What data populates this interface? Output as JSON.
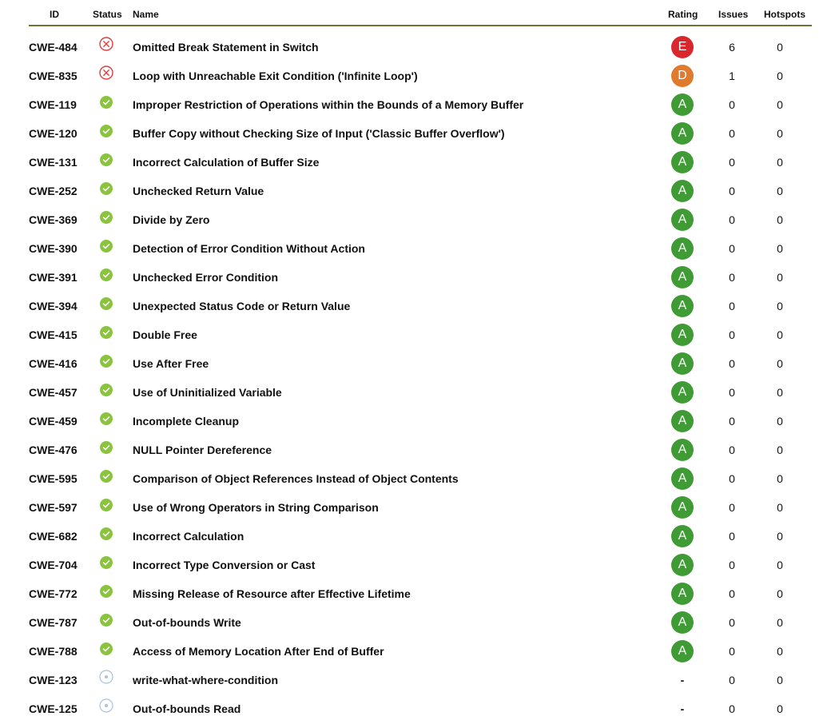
{
  "table": {
    "headers": {
      "id": "ID",
      "status": "Status",
      "name": "Name",
      "rating": "Rating",
      "issues": "Issues",
      "hotspots": "Hotspots"
    },
    "colors": {
      "header_rule": "#6f7431",
      "fail_icon": "#e23c3c",
      "pass_icon": "#8ac43f",
      "na_icon": "#a8c2e0",
      "rating_A": "#3f9b33",
      "rating_D": "#e07a2e",
      "rating_E": "#d9272e"
    },
    "rows": [
      {
        "id": "CWE-484",
        "status": "fail",
        "name": "Omitted Break Statement in Switch",
        "rating": "E",
        "issues": "6",
        "hotspots": "0"
      },
      {
        "id": "CWE-835",
        "status": "fail",
        "name": "Loop with Unreachable Exit Condition ('Infinite Loop')",
        "rating": "D",
        "issues": "1",
        "hotspots": "0"
      },
      {
        "id": "CWE-119",
        "status": "pass",
        "name": "Improper Restriction of Operations within the Bounds of a Memory Buffer",
        "rating": "A",
        "issues": "0",
        "hotspots": "0"
      },
      {
        "id": "CWE-120",
        "status": "pass",
        "name": "Buffer Copy without Checking Size of Input ('Classic Buffer Overflow')",
        "rating": "A",
        "issues": "0",
        "hotspots": "0"
      },
      {
        "id": "CWE-131",
        "status": "pass",
        "name": "Incorrect Calculation of Buffer Size",
        "rating": "A",
        "issues": "0",
        "hotspots": "0"
      },
      {
        "id": "CWE-252",
        "status": "pass",
        "name": "Unchecked Return Value",
        "rating": "A",
        "issues": "0",
        "hotspots": "0"
      },
      {
        "id": "CWE-369",
        "status": "pass",
        "name": "Divide by Zero",
        "rating": "A",
        "issues": "0",
        "hotspots": "0"
      },
      {
        "id": "CWE-390",
        "status": "pass",
        "name": "Detection of Error Condition Without Action",
        "rating": "A",
        "issues": "0",
        "hotspots": "0"
      },
      {
        "id": "CWE-391",
        "status": "pass",
        "name": "Unchecked Error Condition",
        "rating": "A",
        "issues": "0",
        "hotspots": "0"
      },
      {
        "id": "CWE-394",
        "status": "pass",
        "name": "Unexpected Status Code or Return Value",
        "rating": "A",
        "issues": "0",
        "hotspots": "0"
      },
      {
        "id": "CWE-415",
        "status": "pass",
        "name": "Double Free",
        "rating": "A",
        "issues": "0",
        "hotspots": "0"
      },
      {
        "id": "CWE-416",
        "status": "pass",
        "name": "Use After Free",
        "rating": "A",
        "issues": "0",
        "hotspots": "0"
      },
      {
        "id": "CWE-457",
        "status": "pass",
        "name": "Use of Uninitialized Variable",
        "rating": "A",
        "issues": "0",
        "hotspots": "0"
      },
      {
        "id": "CWE-459",
        "status": "pass",
        "name": "Incomplete Cleanup",
        "rating": "A",
        "issues": "0",
        "hotspots": "0"
      },
      {
        "id": "CWE-476",
        "status": "pass",
        "name": "NULL Pointer Dereference",
        "rating": "A",
        "issues": "0",
        "hotspots": "0"
      },
      {
        "id": "CWE-595",
        "status": "pass",
        "name": "Comparison of Object References Instead of Object Contents",
        "rating": "A",
        "issues": "0",
        "hotspots": "0"
      },
      {
        "id": "CWE-597",
        "status": "pass",
        "name": "Use of Wrong Operators in String Comparison",
        "rating": "A",
        "issues": "0",
        "hotspots": "0"
      },
      {
        "id": "CWE-682",
        "status": "pass",
        "name": "Incorrect Calculation",
        "rating": "A",
        "issues": "0",
        "hotspots": "0"
      },
      {
        "id": "CWE-704",
        "status": "pass",
        "name": "Incorrect Type Conversion or Cast",
        "rating": "A",
        "issues": "0",
        "hotspots": "0"
      },
      {
        "id": "CWE-772",
        "status": "pass",
        "name": "Missing Release of Resource after Effective Lifetime",
        "rating": "A",
        "issues": "0",
        "hotspots": "0"
      },
      {
        "id": "CWE-787",
        "status": "pass",
        "name": "Out-of-bounds Write",
        "rating": "A",
        "issues": "0",
        "hotspots": "0"
      },
      {
        "id": "CWE-788",
        "status": "pass",
        "name": "Access of Memory Location After End of Buffer",
        "rating": "A",
        "issues": "0",
        "hotspots": "0"
      },
      {
        "id": "CWE-123",
        "status": "na",
        "name": "write-what-where-condition",
        "rating": "-",
        "issues": "0",
        "hotspots": "0"
      },
      {
        "id": "CWE-125",
        "status": "na",
        "name": "Out-of-bounds Read",
        "rating": "-",
        "issues": "0",
        "hotspots": "0"
      }
    ]
  }
}
